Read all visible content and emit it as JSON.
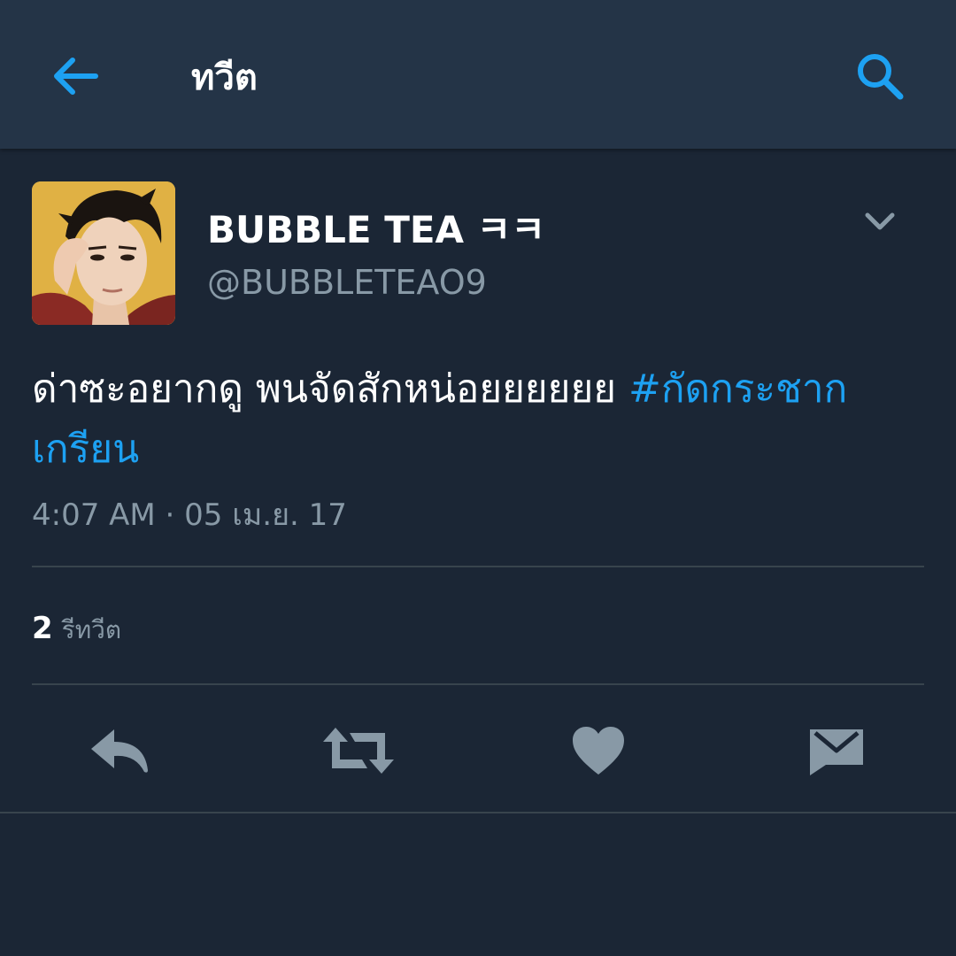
{
  "topbar": {
    "title": "ทวีต",
    "back_icon": "arrow-left-icon",
    "search_icon": "search-icon"
  },
  "tweet": {
    "display_name": "BUBBLE TEA ㅋㅋ",
    "handle": "@BUBBLETEAO9",
    "text": "ด่าซะอยากดู พนจัดสักหน่อยยยยยย",
    "hashtag": "#กัดกระชากเกรียน",
    "timestamp": "4:07 AM · 05 เม.ย. 17",
    "retweet_count": "2",
    "retweet_label": "รีทวีต"
  },
  "actions": {
    "reply_icon": "reply-icon",
    "retweet_icon": "retweet-icon",
    "like_icon": "heart-icon",
    "dm_icon": "envelope-icon"
  },
  "colors": {
    "background": "#1b2635",
    "topbar": "#243447",
    "accent": "#1da1f2",
    "muted": "#8899a6",
    "divider": "#38444d"
  }
}
